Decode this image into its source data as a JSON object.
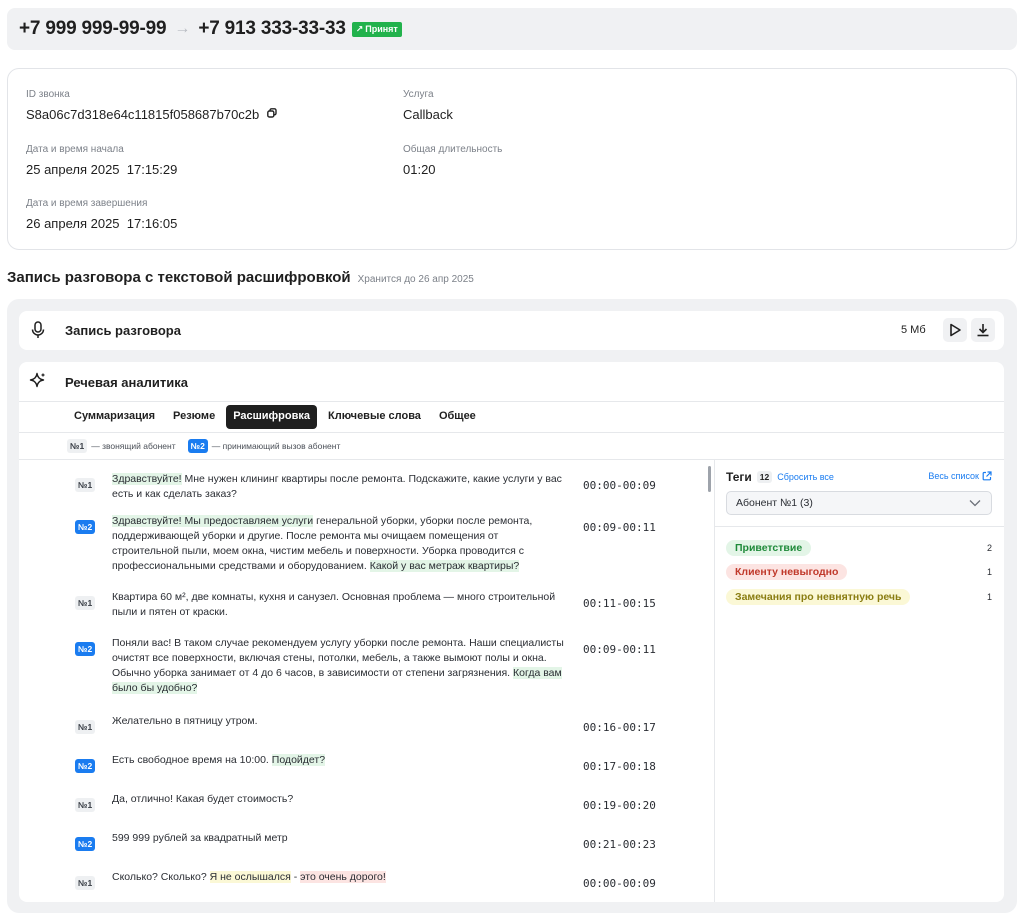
{
  "header": {
    "from_phone": "+7 999 999-99-99",
    "arrow": "→",
    "to_phone": "+7 913 333-33-33",
    "status": "Принят",
    "status_icon": "↗",
    "status_color": "#22b24c"
  },
  "details": {
    "call_id_label": "ID звонка",
    "call_id": "S8a06c7d318e64c11815f058687b70c2b",
    "start_label": "Дата и время начала",
    "start": "25 апреля 2025  17:15:29",
    "end_label": "Дата и время завершения",
    "end": "26 апреля 2025  17:16:05",
    "service_label": "Услуга",
    "service": "Callback",
    "duration_label": "Общая длительность",
    "duration": "01:20"
  },
  "recording_section": {
    "title": "Запись разговора с текстовой расшифровкой",
    "storage_note": "Хранится до 26 апр 2025"
  },
  "recording": {
    "label": "Запись разговора",
    "size": "5 Мб"
  },
  "analytics": {
    "title": "Речевая аналитика",
    "tabs": [
      "Суммаризация",
      "Резюме",
      "Расшифровка",
      "Ключевые слова",
      "Общее"
    ],
    "active_tab": "Расшифровка",
    "legend_n1": "№1",
    "legend_n1_text": "— звонящий абонент",
    "legend_n2": "№2",
    "legend_n2_text": "— принимающий вызов абонент"
  },
  "transcript": [
    {
      "speaker": "№1",
      "time": "00:00-00:09",
      "parts": [
        {
          "t": "Здравствуйте!",
          "h": "g"
        },
        {
          "t": " Мне нужен клининг квартиры после ремонта. Подскажите, какие услуги у вас есть и как сделать заказ?",
          "h": ""
        }
      ]
    },
    {
      "speaker": "№2",
      "time": "00:09-00:11",
      "parts": [
        {
          "t": "Здравствуйте! Мы предоставляем услуги",
          "h": "g"
        },
        {
          "t": " генеральной уборки, уборки после ремонта, поддерживающей уборки и другие. После ремонта мы очищаем помещения от строительной пыли, моем окна, чистим мебель и поверхности. Уборка проводится с профессиональными средствами и оборудованием. ",
          "h": ""
        },
        {
          "t": "Какой у вас метраж квартиры?",
          "h": "g"
        }
      ]
    },
    {
      "speaker": "№1",
      "time": "00:11-00:15",
      "parts": [
        {
          "t": "Квартира 60 м², две комнаты, кухня и санузел. Основная проблема — много строительной пыли и пятен от краски.",
          "h": ""
        }
      ]
    },
    {
      "speaker": "№2",
      "time": "00:09-00:11",
      "parts": [
        {
          "t": "Поняли вас! В таком случае рекомендуем услугу уборки после ремонта. Наши специалисты очистят все поверхности, включая стены, потолки, мебель, а также вымоют полы и окна. Обычно уборка занимает от 4 до 6 часов, в зависимости от степени загрязнения. ",
          "h": ""
        },
        {
          "t": "Когда вам было бы удобно?",
          "h": "g"
        }
      ]
    },
    {
      "speaker": "№1",
      "time": "00:16-00:17",
      "parts": [
        {
          "t": "Желательно в пятницу утром.",
          "h": ""
        }
      ]
    },
    {
      "speaker": "№2",
      "time": "00:17-00:18",
      "parts": [
        {
          "t": "Есть свободное время на 10:00. ",
          "h": ""
        },
        {
          "t": "Подойдет?",
          "h": "g"
        }
      ]
    },
    {
      "speaker": "№1",
      "time": "00:19-00:20",
      "parts": [
        {
          "t": "Да, отлично! Какая будет стоимость?",
          "h": ""
        }
      ]
    },
    {
      "speaker": "№2",
      "time": "00:21-00:23",
      "parts": [
        {
          "t": "599 999 рублей за квадратный метр",
          "h": ""
        }
      ]
    },
    {
      "speaker": "№1",
      "time": "00:00-00:09",
      "parts": [
        {
          "t": "Сколько? Сколько? ",
          "h": ""
        },
        {
          "t": "Я не ослышался",
          "h": "y"
        },
        {
          "t": " - ",
          "h": ""
        },
        {
          "t": "это очень дорого!",
          "h": "r"
        }
      ]
    }
  ],
  "tags": {
    "title": "Теги",
    "count": "12",
    "reset": "Сбросить все",
    "all_list": "Весь список",
    "filter_value": "Абонент №1 (3)",
    "items": [
      {
        "label": "Приветствие",
        "count": "2",
        "bg": "#e3f5e7",
        "fg": "#1f8a3a"
      },
      {
        "label": "Клиенту невыгодно",
        "count": "1",
        "bg": "#fce4e2",
        "fg": "#c0392b"
      },
      {
        "label": "Замечания про невнятную речь",
        "count": "1",
        "bg": "#fbf8d6",
        "fg": "#8a7d12"
      }
    ]
  }
}
